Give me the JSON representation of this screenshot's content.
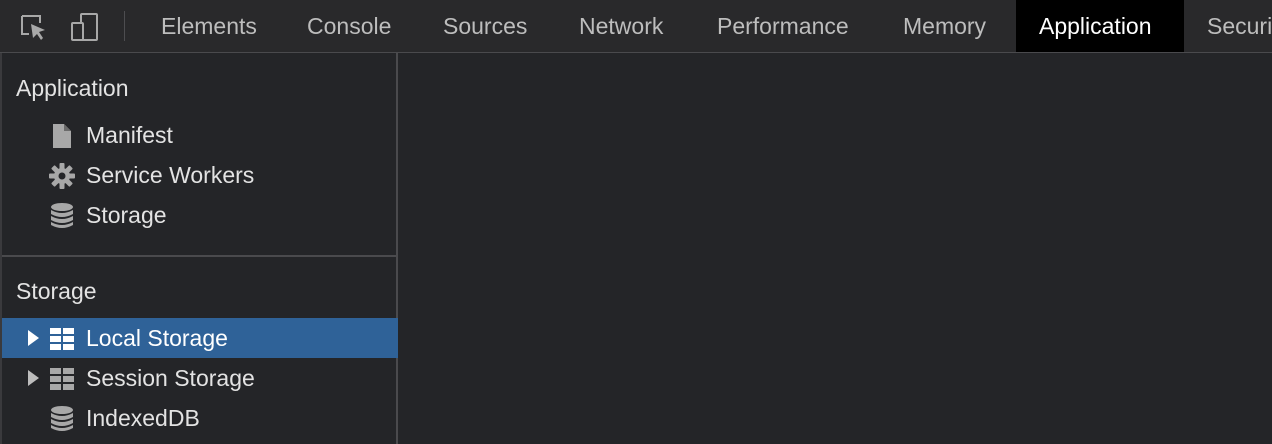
{
  "toolbar": {
    "inspect_icon": "inspect-element-icon",
    "device_icon": "device-toolbar-icon",
    "tabs": [
      {
        "label": "Elements"
      },
      {
        "label": "Console"
      },
      {
        "label": "Sources"
      },
      {
        "label": "Network"
      },
      {
        "label": "Performance"
      },
      {
        "label": "Memory"
      },
      {
        "label": "Application",
        "active": true
      },
      {
        "label": "Securi"
      }
    ]
  },
  "sidebar": {
    "application": {
      "title": "Application",
      "items": [
        {
          "label": "Manifest",
          "icon": "document-icon"
        },
        {
          "label": "Service Workers",
          "icon": "gear-icon"
        },
        {
          "label": "Storage",
          "icon": "database-icon"
        }
      ]
    },
    "storage": {
      "title": "Storage",
      "items": [
        {
          "label": "Local Storage",
          "icon": "table-icon",
          "expandable": true,
          "selected": true
        },
        {
          "label": "Session Storage",
          "icon": "table-icon",
          "expandable": true
        },
        {
          "label": "IndexedDB",
          "icon": "database-icon"
        }
      ]
    }
  },
  "colors": {
    "background": "#242528",
    "toolbar": "#29292b",
    "active_tab": "#000000",
    "selection": "#2f6298",
    "text": "#e3e3e3",
    "muted_text": "#bdbdbd"
  }
}
